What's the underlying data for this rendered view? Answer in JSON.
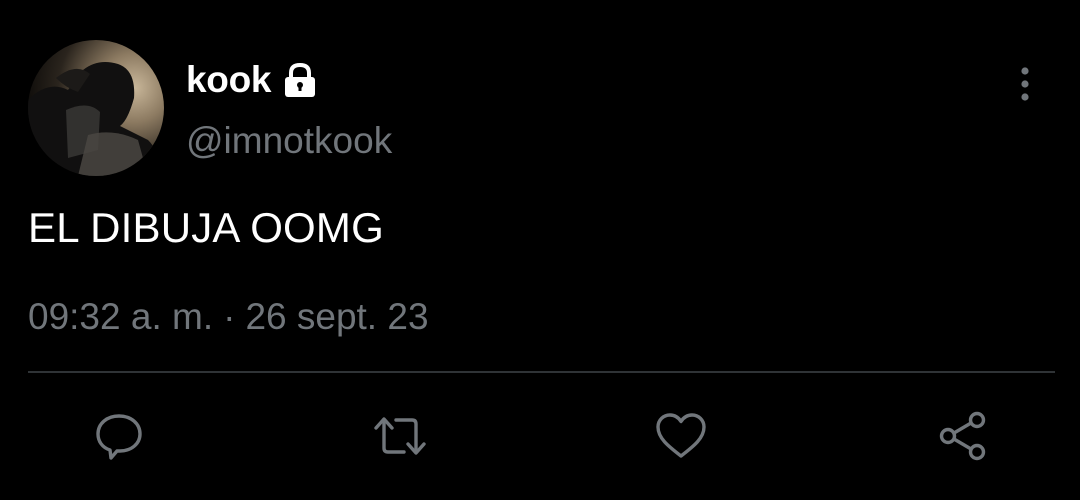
{
  "tweet": {
    "display_name": "kook",
    "handle": "@imnotkook",
    "text": "EL DIBUJA OOMG",
    "time": "09:32 a. m.",
    "separator": "·",
    "date": "26 sept. 23"
  },
  "colors": {
    "background": "#000000",
    "primary_text": "#ffffff",
    "secondary_text": "#71767b",
    "divider": "#2f3336",
    "icon": "#71767b"
  },
  "icons": {
    "protected": "lock-icon",
    "more": "more-vertical-icon",
    "reply": "comment-icon",
    "retweet": "retweet-icon",
    "like": "heart-icon",
    "share": "share-icon"
  }
}
